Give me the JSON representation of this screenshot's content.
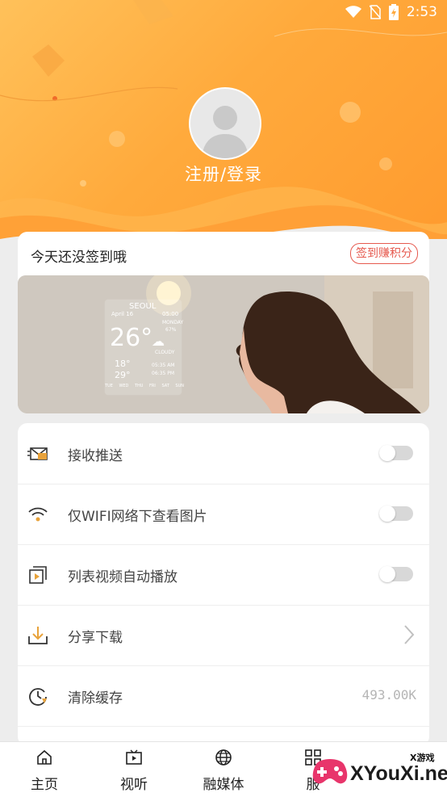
{
  "status_bar": {
    "time": "2:53",
    "icons": [
      "wifi-icon",
      "no-sim-icon",
      "battery-charging-icon"
    ]
  },
  "profile": {
    "login_label": "注册/登录",
    "avatar_icon": "default-user-avatar"
  },
  "signin": {
    "title": "今天还没签到哦",
    "button_label": "签到赚积分",
    "banner": {
      "city": "SEOUL",
      "date": "April 16",
      "time": "05:00",
      "day": "MONDAY",
      "humidity": "67%",
      "temperature": "26°",
      "condition": "CLOUDY",
      "low": "18°",
      "high": "29°",
      "sunrise": "05:35 AM",
      "sunset": "06:35 PM",
      "forecast_days": [
        "TUE",
        "WED",
        "THU",
        "FRI",
        "SAT",
        "SUN"
      ]
    }
  },
  "settings": {
    "items": [
      {
        "icon": "envelope-icon",
        "label": "接收推送",
        "control": "toggle",
        "on": false
      },
      {
        "icon": "wifi-icon",
        "label": "仅WIFI网络下查看图片",
        "control": "toggle",
        "on": false
      },
      {
        "icon": "play-video-icon",
        "label": "列表视频自动播放",
        "control": "toggle",
        "on": false
      },
      {
        "icon": "download-icon",
        "label": "分享下载",
        "control": "chevron"
      },
      {
        "icon": "clock-refresh-icon",
        "label": "清除缓存",
        "control": "value",
        "value": "493.00K"
      }
    ]
  },
  "tabbar": {
    "tabs": [
      {
        "icon": "home-icon",
        "label": "主页"
      },
      {
        "icon": "tv-play-icon",
        "label": "视听"
      },
      {
        "icon": "globe-icon",
        "label": "融媒体"
      },
      {
        "icon": "grid-apps-icon",
        "label": "服"
      }
    ]
  },
  "watermark": {
    "text": "XYouXi.net",
    "small": "X游戏"
  },
  "colors": {
    "accent": "#ff9a2e",
    "signin_red": "#e65a4f",
    "toggle_off": "#d8d8d8",
    "icon_orange": "#e8a23a"
  }
}
